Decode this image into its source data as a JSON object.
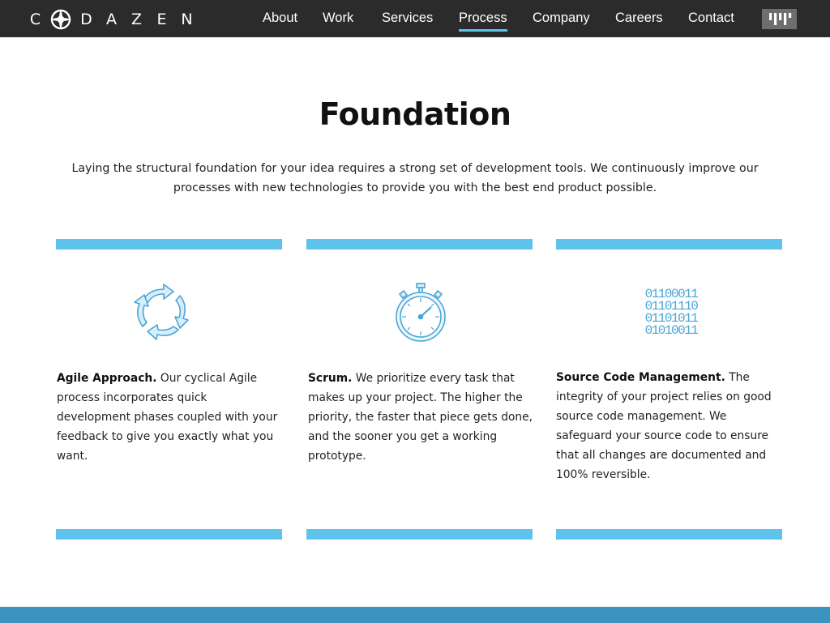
{
  "brand": {
    "letters_left": [
      "C"
    ],
    "letters_right": [
      "D",
      "A",
      "Z",
      "E",
      "N"
    ]
  },
  "nav": {
    "items": [
      {
        "label": "About"
      },
      {
        "label": "Work"
      },
      {
        "label": "Services"
      },
      {
        "label": "Process"
      },
      {
        "label": "Company"
      },
      {
        "label": "Careers"
      },
      {
        "label": "Contact"
      }
    ],
    "active": "Process",
    "menu_icon": "bars-logo-icon"
  },
  "main": {
    "title": "Foundation",
    "intro": "Laying the structural foundation for your idea requires a strong set of development tools. We continuously improve our processes with new technologies to provide you with the best end product possible."
  },
  "features": [
    {
      "heading": "Agile Approach.",
      "body": " Our cyclical Agile process incorporates quick development phases coupled with your feedback to give you exactly what you want.",
      "icon": "cycle-arrows-icon"
    },
    {
      "heading": "Scrum.",
      "body": " We prioritize every task that makes up your project. The higher the priority, the faster that piece gets done, and the sooner you get a working prototype.",
      "icon": "stopwatch-icon"
    },
    {
      "heading": "Source Code Management.",
      "body": " The integrity of your project relies on good source code management. We safeguard your source code to ensure that all changes are documented and 100% reversible.",
      "icon": "binary-code-icon",
      "binary_rows": [
        "01100011",
        "01101110",
        "01101011",
        "01010011"
      ]
    }
  ],
  "colors": {
    "nav_bg": "#2b2b2b",
    "accent": "#5ec3ec",
    "footer": "#3b93c0",
    "icon_stroke": "#4aa6d6"
  }
}
